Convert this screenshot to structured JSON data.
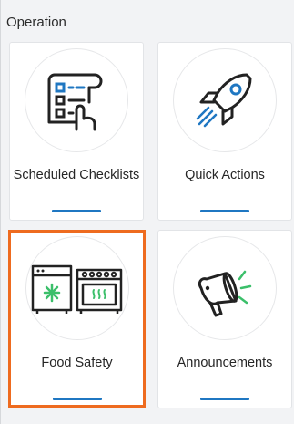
{
  "section": {
    "title": "Operation"
  },
  "cards": [
    {
      "label": "Scheduled Checklists",
      "icon": "checklist-icon",
      "selected": false
    },
    {
      "label": "Quick Actions",
      "icon": "rocket-icon",
      "selected": false
    },
    {
      "label": "Food Safety",
      "icon": "food-safety-icon",
      "selected": true
    },
    {
      "label": "Announcements",
      "icon": "megaphone-icon",
      "selected": false
    }
  ],
  "colors": {
    "accent_bar": "#1f77c2",
    "selected_border": "#ee6b1f",
    "icon_blue": "#1f77c2",
    "icon_green": "#3bbf6a",
    "icon_dark": "#222222"
  }
}
